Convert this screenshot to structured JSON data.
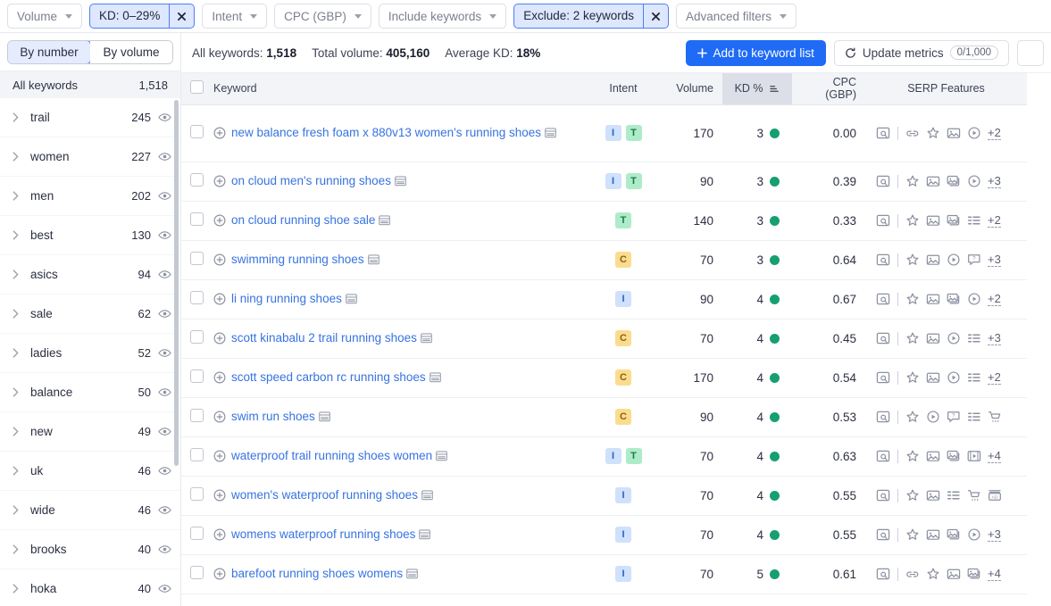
{
  "filters": [
    {
      "label": "Volume",
      "type": "dropdown",
      "active": false
    },
    {
      "label": "KD: 0–29%",
      "type": "chip",
      "active": true,
      "close": "✕"
    },
    {
      "label": "Intent",
      "type": "dropdown",
      "active": false
    },
    {
      "label": "CPC (GBP)",
      "type": "dropdown",
      "active": false
    },
    {
      "label": "Include keywords",
      "type": "dropdown",
      "active": false
    },
    {
      "label": "Exclude: 2 keywords",
      "type": "chip",
      "active": true,
      "close": "✕"
    },
    {
      "label": "Advanced filters",
      "type": "dropdown",
      "active": false
    }
  ],
  "sidebar": {
    "segments": [
      {
        "label": "By number",
        "selected": true
      },
      {
        "label": "By volume",
        "selected": false
      }
    ],
    "all_keywords": {
      "label": "All keywords",
      "count": "1,518"
    },
    "groups": [
      {
        "label": "trail",
        "count": "245"
      },
      {
        "label": "women",
        "count": "227"
      },
      {
        "label": "men",
        "count": "202"
      },
      {
        "label": "best",
        "count": "130"
      },
      {
        "label": "asics",
        "count": "94"
      },
      {
        "label": "sale",
        "count": "62"
      },
      {
        "label": "ladies",
        "count": "52"
      },
      {
        "label": "balance",
        "count": "50"
      },
      {
        "label": "new",
        "count": "49"
      },
      {
        "label": "uk",
        "count": "46"
      },
      {
        "label": "wide",
        "count": "46"
      },
      {
        "label": "brooks",
        "count": "40"
      },
      {
        "label": "hoka",
        "count": "40"
      }
    ]
  },
  "toolbar": {
    "stats": [
      {
        "label": "All keywords:",
        "value": "1,518"
      },
      {
        "label": "Total volume:",
        "value": "405,160"
      },
      {
        "label": "Average KD:",
        "value": "18%"
      }
    ],
    "add_button": {
      "icon": "plus-icon",
      "label": "Add to keyword list"
    },
    "update_button": {
      "icon": "refresh-icon",
      "label": "Update metrics",
      "counter": "0/1,000"
    }
  },
  "table": {
    "columns": [
      {
        "key": "checkbox",
        "label": ""
      },
      {
        "key": "keyword",
        "label": "Keyword"
      },
      {
        "key": "intent",
        "label": "Intent"
      },
      {
        "key": "volume",
        "label": "Volume"
      },
      {
        "key": "kd",
        "label": "KD %",
        "sorted": true,
        "sort_icon": "sort-ascending-icon"
      },
      {
        "key": "cpc",
        "label": "CPC (GBP)"
      },
      {
        "key": "serp",
        "label": "SERP Features"
      }
    ],
    "rows": [
      {
        "keyword": "new balance fresh foam x 880v13 women's running shoes",
        "intent": [
          "I",
          "T"
        ],
        "volume": "170",
        "kd": "3",
        "cpc": "0.00",
        "serp": [
          "site-links-icon",
          "divider",
          "link-icon",
          "star-icon",
          "image-icon",
          "video-icon"
        ],
        "more": "+2"
      },
      {
        "keyword": "on cloud men's running shoes",
        "intent": [
          "I",
          "T"
        ],
        "volume": "90",
        "kd": "3",
        "cpc": "0.39",
        "serp": [
          "site-links-icon",
          "divider",
          "star-icon",
          "image-icon",
          "image-pack-icon",
          "video-icon"
        ],
        "more": "+3"
      },
      {
        "keyword": "on cloud running shoe sale",
        "intent": [
          "T"
        ],
        "volume": "140",
        "kd": "3",
        "cpc": "0.33",
        "serp": [
          "site-links-icon",
          "divider",
          "star-icon",
          "image-icon",
          "image-pack-icon",
          "list-icon"
        ],
        "more": "+2"
      },
      {
        "keyword": "swimming running shoes",
        "intent": [
          "C"
        ],
        "volume": "70",
        "kd": "3",
        "cpc": "0.64",
        "serp": [
          "site-links-icon",
          "divider",
          "star-icon",
          "image-icon",
          "video-icon",
          "faq-icon"
        ],
        "more": "+3"
      },
      {
        "keyword": "li ning running shoes",
        "intent": [
          "I"
        ],
        "volume": "90",
        "kd": "4",
        "cpc": "0.67",
        "serp": [
          "site-links-icon",
          "divider",
          "star-icon",
          "image-icon",
          "image-pack-icon",
          "video-icon"
        ],
        "more": "+2"
      },
      {
        "keyword": "scott kinabalu 2 trail running shoes",
        "intent": [
          "C"
        ],
        "volume": "70",
        "kd": "4",
        "cpc": "0.45",
        "serp": [
          "site-links-icon",
          "divider",
          "star-icon",
          "image-icon",
          "video-icon",
          "list-icon"
        ],
        "more": "+3"
      },
      {
        "keyword": "scott speed carbon rc running shoes",
        "intent": [
          "C"
        ],
        "volume": "170",
        "kd": "4",
        "cpc": "0.54",
        "serp": [
          "site-links-icon",
          "divider",
          "star-icon",
          "image-icon",
          "video-icon",
          "list-icon"
        ],
        "more": "+2"
      },
      {
        "keyword": "swim run shoes",
        "intent": [
          "C"
        ],
        "volume": "90",
        "kd": "4",
        "cpc": "0.53",
        "serp": [
          "site-links-icon",
          "divider",
          "star-icon",
          "video-icon",
          "faq-icon",
          "list-icon",
          "shopping-icon"
        ],
        "more": ""
      },
      {
        "keyword": "waterproof trail running shoes women",
        "intent": [
          "I",
          "T"
        ],
        "volume": "70",
        "kd": "4",
        "cpc": "0.63",
        "serp": [
          "site-links-icon",
          "divider",
          "star-icon",
          "image-icon",
          "image-pack-icon",
          "video-box-icon"
        ],
        "more": "+4"
      },
      {
        "keyword": "women's waterproof running shoes",
        "intent": [
          "I"
        ],
        "volume": "70",
        "kd": "4",
        "cpc": "0.55",
        "serp": [
          "site-links-icon",
          "divider",
          "star-icon",
          "image-icon",
          "list-icon",
          "shopping-icon",
          "ads-icon"
        ],
        "more": ""
      },
      {
        "keyword": "womens waterproof running shoes",
        "intent": [
          "I"
        ],
        "volume": "70",
        "kd": "4",
        "cpc": "0.55",
        "serp": [
          "site-links-icon",
          "divider",
          "star-icon",
          "image-icon",
          "image-pack-icon",
          "video-icon"
        ],
        "more": "+3"
      },
      {
        "keyword": "barefoot running shoes womens",
        "intent": [
          "I"
        ],
        "volume": "70",
        "kd": "5",
        "cpc": "0.61",
        "serp": [
          "site-links-icon",
          "divider",
          "link-icon",
          "star-icon",
          "image-icon",
          "image-pack-icon"
        ],
        "more": "+4"
      }
    ]
  },
  "colors": {
    "accent": "#1f6bf5",
    "link": "#3773e0",
    "kd_dot_green": "#16a06f",
    "intent_I": "#cfe1fb",
    "intent_T": "#aeecc9",
    "intent_C": "#fbdc8f",
    "header_bg": "#f2f4f8",
    "sorted_header_bg": "#dcdfe7"
  }
}
